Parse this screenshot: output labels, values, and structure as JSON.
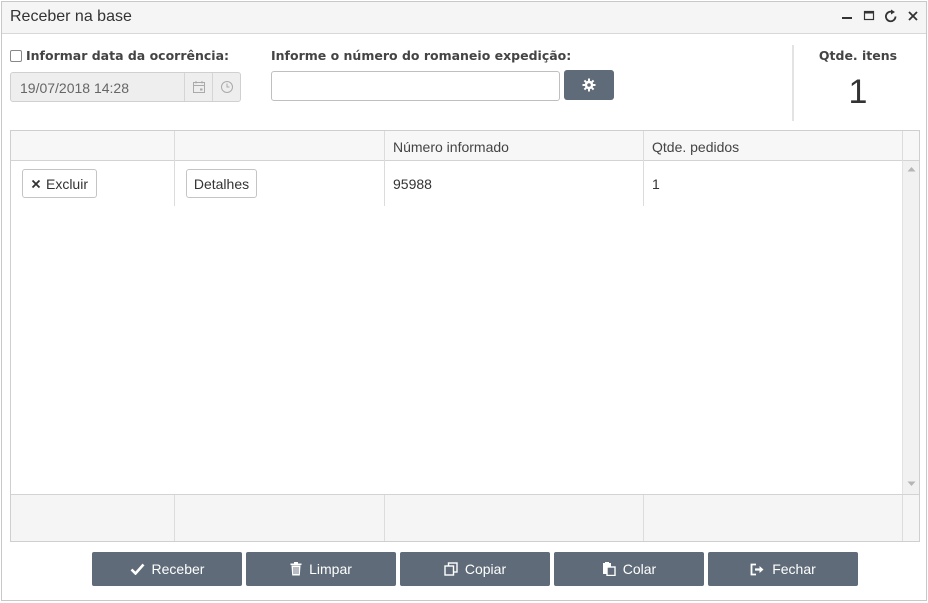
{
  "window": {
    "title": "Receber na base"
  },
  "form": {
    "date_checkbox_label": "Informar data da ocorrência:",
    "date_value": "19/07/2018 14:28",
    "romaneio_label": "Informe o número do romaneio expedição:",
    "romaneio_value": "",
    "romaneio_placeholder": ""
  },
  "summary": {
    "label": "Qtde. itens",
    "value": "1"
  },
  "grid": {
    "columns": [
      "",
      "",
      "Número informado",
      "Qtde. pedidos"
    ],
    "rows": [
      {
        "delete_label": "Excluir",
        "details_label": "Detalhes",
        "numero": "95988",
        "qtde_pedidos": "1"
      }
    ]
  },
  "actions": {
    "receber": "Receber",
    "limpar": "Limpar",
    "copiar": "Copiar",
    "colar": "Colar",
    "fechar": "Fechar"
  },
  "colors": {
    "button_bg": "#5f6b78",
    "titlebar_bg": "#f5f5f5"
  }
}
